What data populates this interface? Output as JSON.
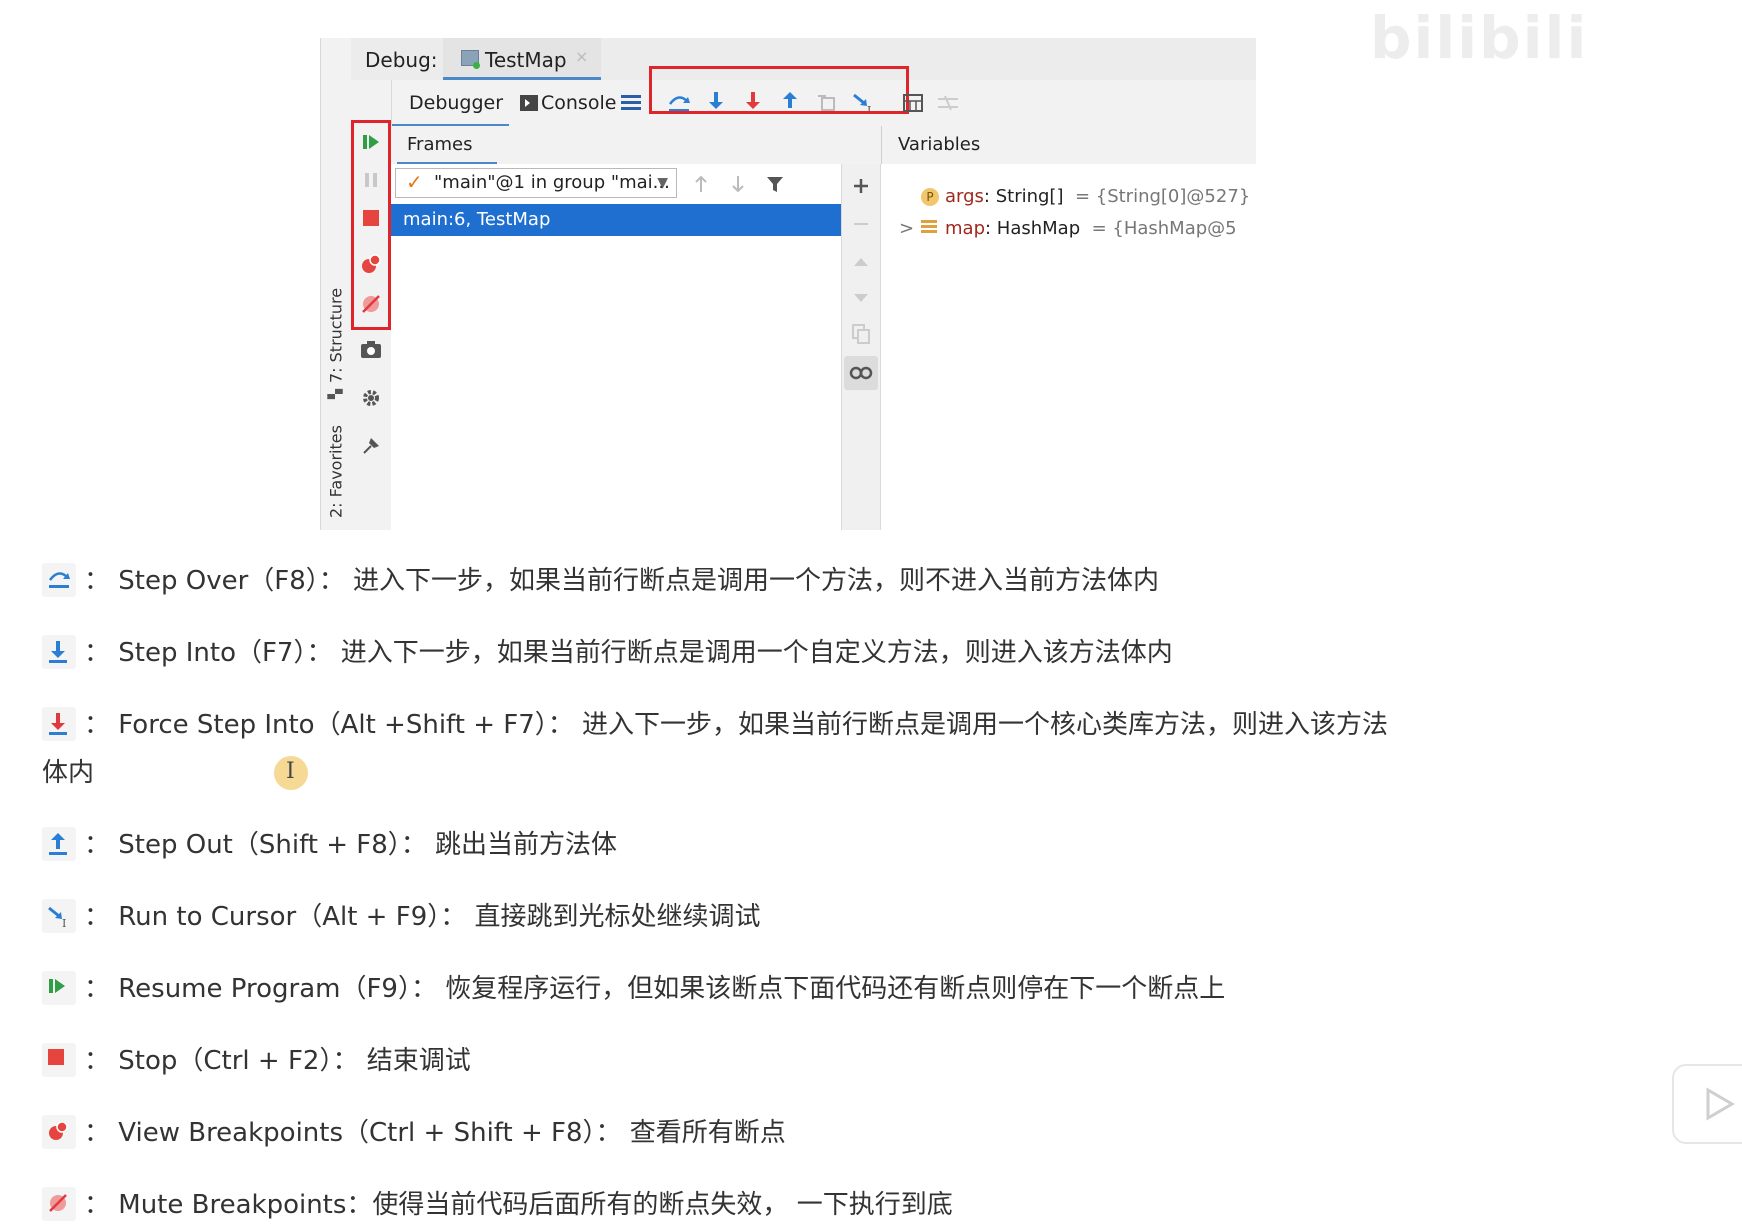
{
  "watermark": "bilibili",
  "ide": {
    "debug_label": "Debug:",
    "run_tab": "TestMap",
    "tab_close": "×",
    "toolbar": {
      "debugger_tab": "Debugger",
      "console_tab": "Console"
    },
    "side_tabs": {
      "structure": "7: Structure",
      "favorites": "2: Favorites"
    },
    "frames_header": "Frames",
    "variables_header": "Variables",
    "thread_selector": "\"main\"@1 in group \"mai...",
    "frames": [
      "main:6, TestMap"
    ],
    "variables": [
      {
        "badge": "P",
        "name": "args",
        "type": ": String[]",
        "value": "= {String[0]@527}"
      },
      {
        "expand": ">",
        "name": "map",
        "type": ": HashMap",
        "value": "= {HashMap@5"
      }
    ],
    "colors": {
      "highlight": "#e0242b",
      "selection": "#1f6fd1",
      "accent": "#4a88c7"
    }
  },
  "items": [
    {
      "icon": "step-over-icon",
      "text": "：  Step Over（F8）：  进入下一步，如果当前行断点是调用一个方法，则不进入当前方法体内"
    },
    {
      "icon": "step-into-icon",
      "text": "：  Step Into（F7）：  进入下一步，如果当前行断点是调用一个自定义方法，则进入该方法体内"
    },
    {
      "icon": "force-step-into-icon",
      "text": "：  Force Step Into（Alt +Shift  + F7）：  进入下一步，如果当前行断点是调用一个核心类库方法，则进入该方法",
      "cont": "体内"
    },
    {
      "icon": "step-out-icon",
      "text": "：  Step Out（Shift  + F8）：  跳出当前方法体"
    },
    {
      "icon": "run-to-cursor-icon",
      "text": "：  Run to Cursor（Alt + F9）：  直接跳到光标处继续调试"
    },
    {
      "icon": "resume-program-icon",
      "text": "：  Resume Program（F9）：  恢复程序运行，但如果该断点下面代码还有断点则停在下一个断点上"
    },
    {
      "icon": "stop-icon",
      "text": "：  Stop（Ctrl + F2）：  结束调试"
    },
    {
      "icon": "view-breakpoints-icon",
      "text": "：  View Breakpoints（Ctrl + Shift  + F8）：  查看所有断点"
    },
    {
      "icon": "mute-breakpoints-icon",
      "text": "：  Mute Breakpoints：使得当前代码后面所有的断点失效，  一下执行到底"
    }
  ]
}
